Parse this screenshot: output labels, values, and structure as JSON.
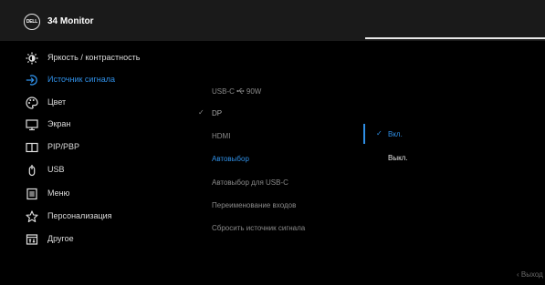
{
  "header": {
    "logo_text": "DELL",
    "model": "34 Monitor"
  },
  "menu": [
    {
      "label": "Яркость / контрастность",
      "icon": "brightness-icon",
      "active": false
    },
    {
      "label": "Источник сигнала",
      "icon": "input-source-icon",
      "active": true
    },
    {
      "label": "Цвет",
      "icon": "color-palette-icon",
      "active": false
    },
    {
      "label": "Экран",
      "icon": "display-icon",
      "active": false
    },
    {
      "label": "PIP/PBP",
      "icon": "pip-pbp-icon",
      "active": false
    },
    {
      "label": "USB",
      "icon": "usb-icon",
      "active": false
    },
    {
      "label": "Меню",
      "icon": "menu-list-icon",
      "active": false
    },
    {
      "label": "Персонализация",
      "icon": "star-icon",
      "active": false
    },
    {
      "label": "Другое",
      "icon": "other-icon",
      "active": false
    }
  ],
  "options": [
    {
      "label_pre": "USB-C",
      "label_post": "90W",
      "checked": false
    },
    {
      "label": "DP",
      "checked": true
    },
    {
      "label": "HDMI",
      "checked": false
    },
    {
      "label": "Автовыбор",
      "checked": false,
      "active": true
    },
    {
      "label": "Автовыбор для USB-C",
      "checked": false
    },
    {
      "label": "Переименование входов",
      "checked": false
    },
    {
      "label": "Сбросить  источник сигнала",
      "checked": false
    }
  ],
  "submenu": [
    {
      "label": "Вкл.",
      "checked": true
    },
    {
      "label": "Выкл.",
      "checked": false
    }
  ],
  "check_glyph": "✓",
  "exit_label": "Выход",
  "colors": {
    "accent": "#2f8fe6",
    "background": "#000000",
    "header_bg": "#1a1a1a"
  }
}
